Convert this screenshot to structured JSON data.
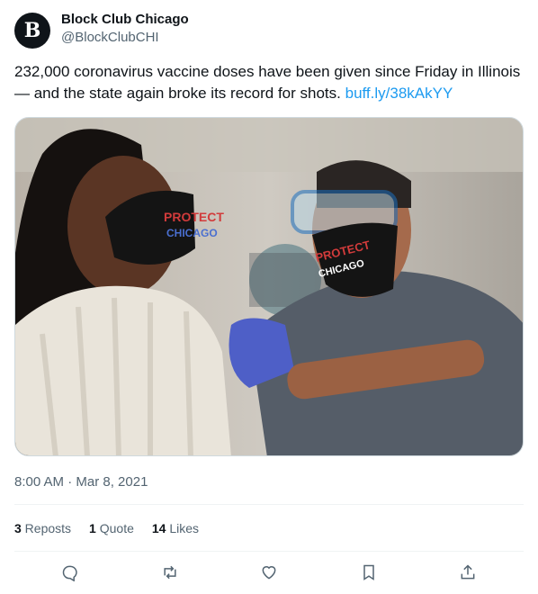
{
  "account": {
    "avatar_letter": "B",
    "display_name": "Block Club Chicago",
    "handle": "@BlockClubCHI"
  },
  "tweet": {
    "text": "232,000 coronavirus vaccine doses have been given since Friday in Illinois — and the state again broke its record for shots.",
    "link_text": "buff.ly/38kAkYY",
    "timestamp": "8:00 AM · Mar 8, 2021"
  },
  "media": {
    "mask_text_left_1": "PROTECT",
    "mask_text_left_2": "CHICAGO",
    "mask_text_right_1": "PROTECT",
    "mask_text_right_2": "CHICAGO"
  },
  "stats": {
    "reposts_count": "3",
    "reposts_label": " Reposts",
    "quotes_count": "1",
    "quotes_label": " Quote",
    "likes_count": "14",
    "likes_label": " Likes"
  },
  "colors": {
    "link": "#1d9bf0",
    "secondary_text": "#536471",
    "icon": "#536471"
  },
  "actions": [
    "reply-icon",
    "repost-icon",
    "like-icon",
    "bookmark-icon",
    "share-icon"
  ]
}
